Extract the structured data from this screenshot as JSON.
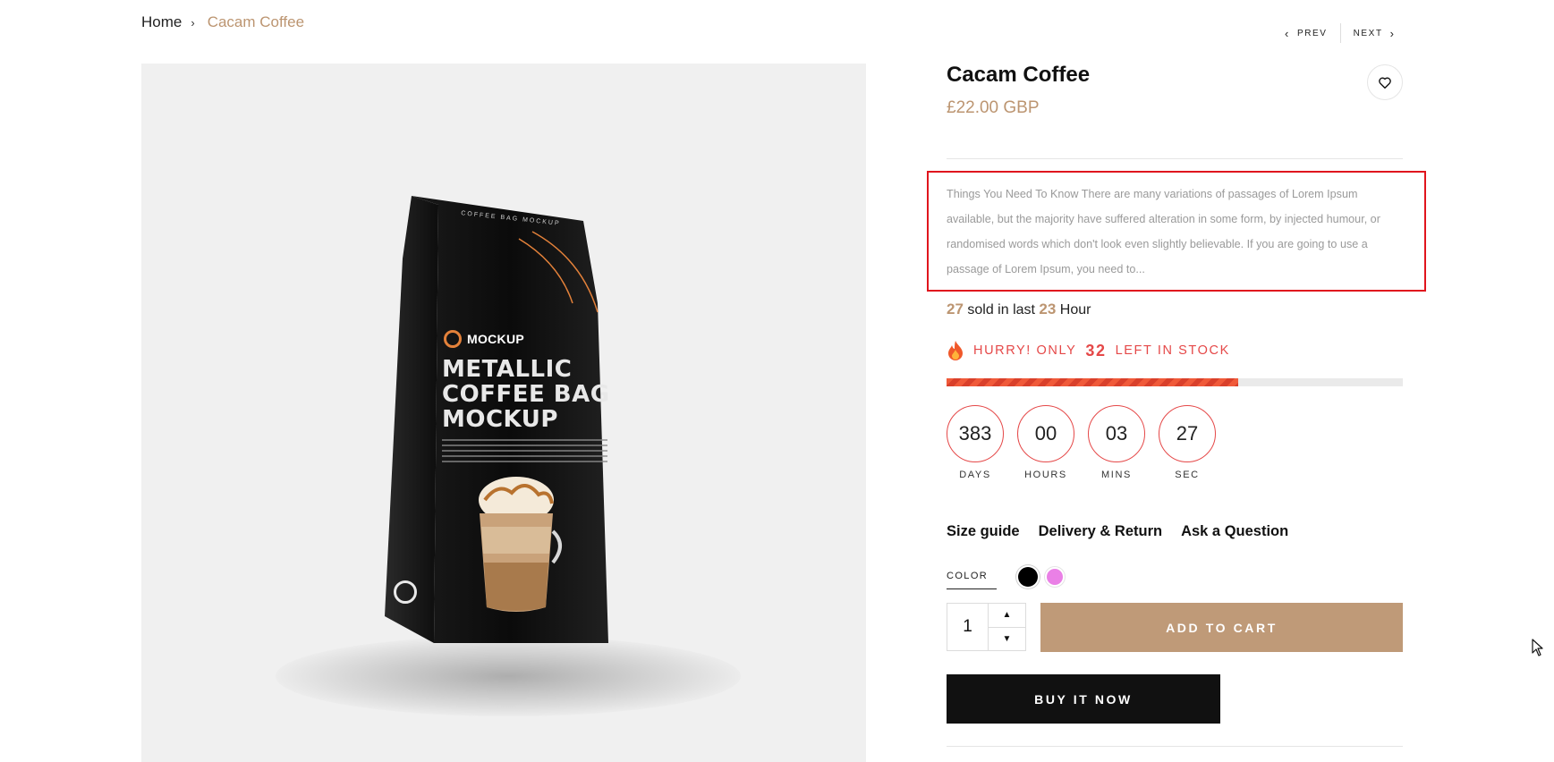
{
  "breadcrumb": {
    "home": "Home",
    "separator": "›",
    "current": "Cacam Coffee"
  },
  "pager": {
    "prev": "PREV",
    "next": "NEXT"
  },
  "product_image": {
    "header_text": "COFFEE BAG MOCKUP",
    "brand": "MOCKUP",
    "headline_1": "METALLIC",
    "headline_2": "COFFEE BAG",
    "headline_3": "MOCKUP"
  },
  "product": {
    "title": "Cacam Coffee",
    "price": "£22.00 GBP",
    "description": "Things You Need To Know There are many variations of passages of Lorem Ipsum available, but the majority have suffered alteration in some form, by injected humour, or randomised words which don't look even slightly believable. If you are going to use a passage of Lorem Ipsum, you need to..."
  },
  "sold": {
    "count": "27",
    "text_mid": "sold in last",
    "hours": "23",
    "text_end": "Hour"
  },
  "stock": {
    "prefix": "HURRY! ONLY",
    "count": "32",
    "suffix": "LEFT IN STOCK",
    "progress_fraction": 0.64
  },
  "countdown": [
    {
      "value": "383",
      "label": "DAYS"
    },
    {
      "value": "00",
      "label": "HOURS"
    },
    {
      "value": "03",
      "label": "MINS"
    },
    {
      "value": "27",
      "label": "SEC"
    }
  ],
  "links": {
    "size_guide": "Size guide",
    "delivery": "Delivery & Return",
    "ask": "Ask a Question"
  },
  "color": {
    "label": "COLOR",
    "options": [
      "black",
      "pink"
    ],
    "selected": "black",
    "swatch_colors": [
      "#000000",
      "#ea80e6"
    ]
  },
  "quantity": {
    "value": "1"
  },
  "buttons": {
    "add_to_cart": "ADD TO CART",
    "buy_now": "BUY IT NOW"
  },
  "colors": {
    "accent": "#bc9571",
    "alert": "#e54848",
    "cart_button": "#bf9a78",
    "buy_button": "#111111",
    "highlight_box": "#e0151d"
  },
  "icons": {
    "wishlist": "heart-icon",
    "prev": "chevron-left-icon",
    "next": "chevron-right-icon",
    "hurry": "flame-icon",
    "qty_up": "caret-up-icon",
    "qty_down": "caret-down-icon"
  }
}
